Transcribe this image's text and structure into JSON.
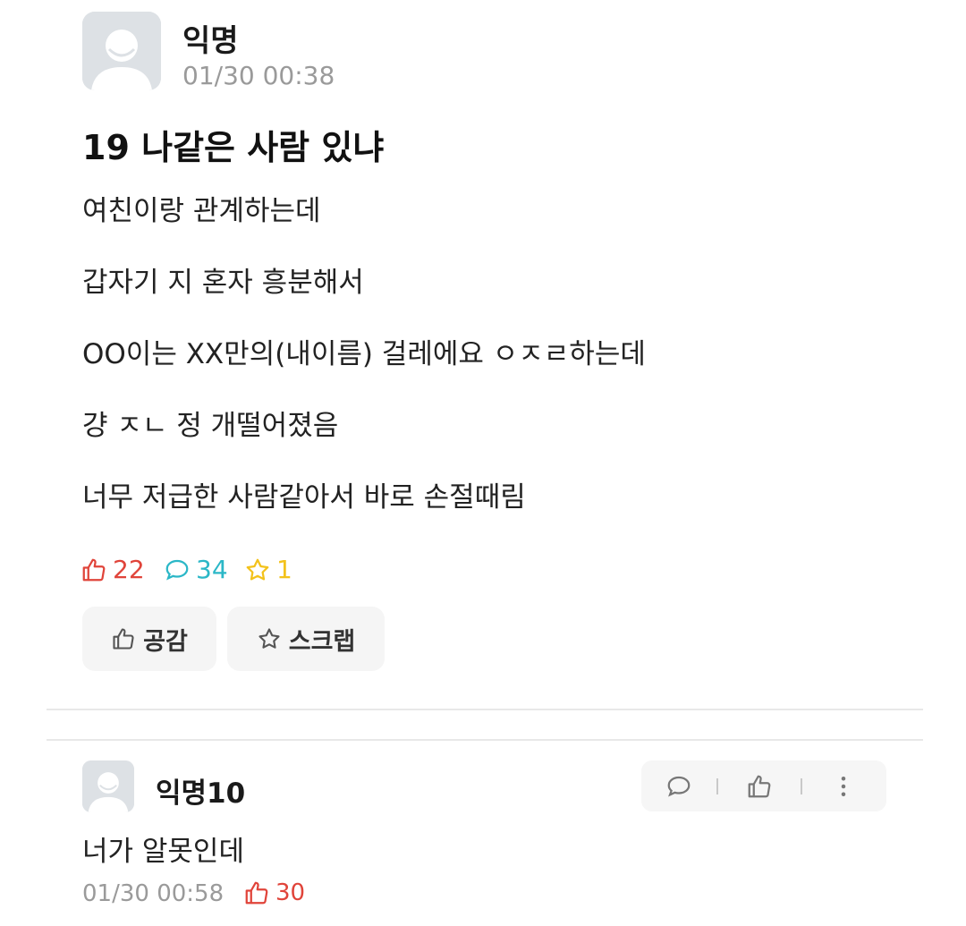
{
  "post": {
    "author": "익명",
    "date": "01/30 00:38",
    "title": "19 나같은 사람 있냐",
    "lines": [
      "여친이랑 관계하는데",
      "갑자기 지 혼자 흥분해서",
      "OO이는 XX만의(내이름) 걸레에요 ㅇㅈㄹ하는데",
      "걍 ㅈㄴ 정 개떨어졌음",
      "너무 저급한 사람같아서 바로 손절때림"
    ],
    "stats": {
      "likes": "22",
      "comments": "34",
      "scraps": "1"
    },
    "buttons": {
      "like": "공감",
      "scrap": "스크랩"
    }
  },
  "comment": {
    "author": "익명10",
    "text": "너가 알못인데",
    "date": "01/30 00:58",
    "likes": "30"
  },
  "colors": {
    "like_red": "#e0443a",
    "comment_teal": "#2bb7c7",
    "scrap_yellow": "#f3c21b",
    "date_gray": "#9a9a9a"
  }
}
